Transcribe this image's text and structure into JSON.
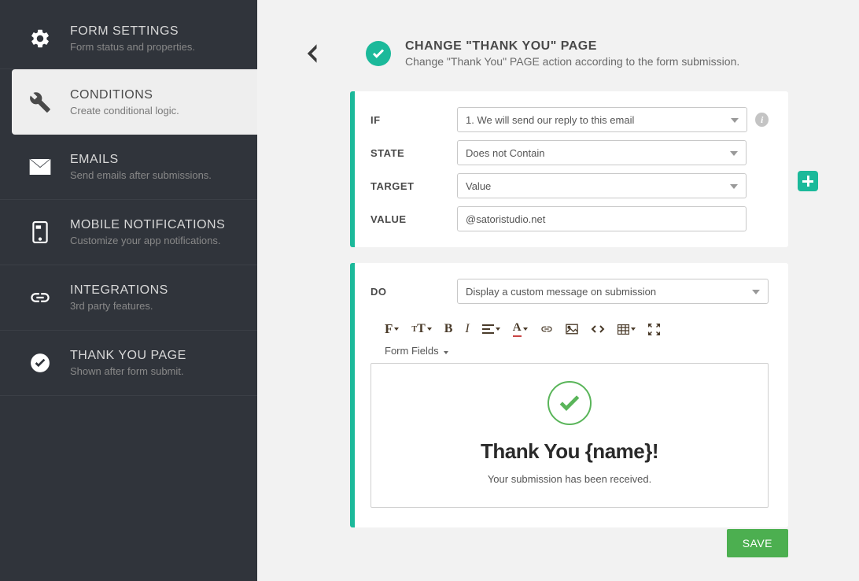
{
  "sidebar": {
    "items": [
      {
        "title": "FORM SETTINGS",
        "sub": "Form status and properties."
      },
      {
        "title": "CONDITIONS",
        "sub": "Create conditional logic."
      },
      {
        "title": "EMAILS",
        "sub": "Send emails after submissions."
      },
      {
        "title": "MOBILE NOTIFICATIONS",
        "sub": "Customize your app notifications."
      },
      {
        "title": "INTEGRATIONS",
        "sub": "3rd party features."
      },
      {
        "title": "THANK YOU PAGE",
        "sub": "Shown after form submit."
      }
    ]
  },
  "header": {
    "title": "CHANGE \"THANK YOU\" PAGE",
    "sub": "Change \"Thank You\" PAGE action according to the form submission."
  },
  "condition": {
    "if_label": "IF",
    "if_value": "1. We will send our reply to this email",
    "state_label": "STATE",
    "state_value": "Does not Contain",
    "target_label": "TARGET",
    "target_value": "Value",
    "value_label": "VALUE",
    "value_input": "@satoristudio.net"
  },
  "action": {
    "do_label": "DO",
    "do_value": "Display a custom message on submission",
    "form_fields_label": "Form Fields"
  },
  "editor": {
    "title": "Thank You {name}!",
    "sub": "Your submission has been received."
  },
  "buttons": {
    "save": "SAVE"
  }
}
